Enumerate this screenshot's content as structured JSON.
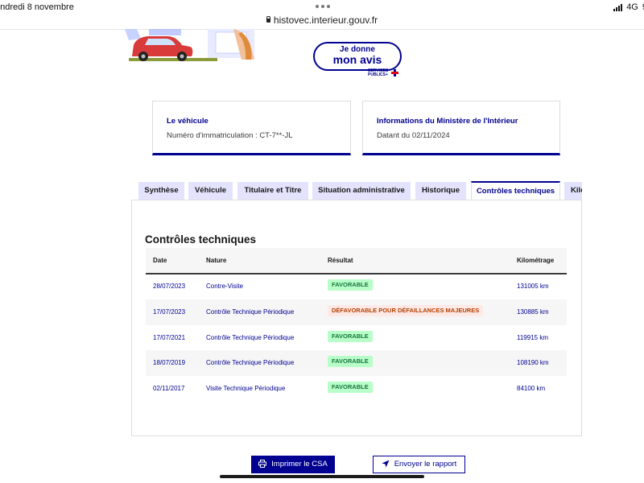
{
  "status": {
    "left": "endredi 8 novembre",
    "network": "4G",
    "battery_partial": "9"
  },
  "browser": {
    "url": "histovec.interieur.gouv.fr"
  },
  "avis": {
    "line1": "Je donne",
    "line2": "mon avis",
    "logo_l1": "SERVICES",
    "logo_l2": "PUBLICS+"
  },
  "cards": [
    {
      "title": "Le véhicule",
      "text": "Numéro d'immatriculation : CT-7**-JL"
    },
    {
      "title": "Informations du Ministère de l'Intérieur",
      "text": "Datant du 02/11/2024"
    }
  ],
  "tabs": [
    {
      "label": "Synthèse",
      "active": false
    },
    {
      "label": "Véhicule",
      "active": false
    },
    {
      "label": "Titulaire et Titre",
      "active": false
    },
    {
      "label": "Situation administrative",
      "active": false
    },
    {
      "label": "Historique",
      "active": false
    },
    {
      "label": "Contrôles techniques",
      "active": true
    },
    {
      "label": "Kilo",
      "active": false
    }
  ],
  "section": {
    "title": "Contrôles techniques"
  },
  "table": {
    "headers": [
      "Date",
      "Nature",
      "Résultat",
      "Kilométrage"
    ],
    "rows": [
      {
        "date": "28/07/2023",
        "nature": "Contre-Visite",
        "result": "FAVORABLE",
        "status": "ok",
        "km": "131005 km"
      },
      {
        "date": "17/07/2023",
        "nature": "Contrôle Technique Périodique",
        "result": "DÉFAVORABLE POUR DÉFAILLANCES MAJEURES",
        "status": "ko",
        "km": "130885 km"
      },
      {
        "date": "17/07/2021",
        "nature": "Contrôle Technique Périodique",
        "result": "FAVORABLE",
        "status": "ok",
        "km": "119915 km"
      },
      {
        "date": "18/07/2019",
        "nature": "Contrôle Technique Périodique",
        "result": "FAVORABLE",
        "status": "ok",
        "km": "108190 km"
      },
      {
        "date": "02/11/2017",
        "nature": "Visite Technique Périodique",
        "result": "FAVORABLE",
        "status": "ok",
        "km": "84100 km"
      }
    ]
  },
  "buttons": {
    "print": "Imprimer le CSA",
    "send": "Envoyer le rapport"
  },
  "colors": {
    "primary": "#000091",
    "ok_bg": "#b8fec9",
    "ok_text": "#18753c",
    "ko_bg": "#ffe9e6",
    "ko_text": "#b34000"
  },
  "icons": {
    "print": "printer-icon",
    "send": "send-icon",
    "lock": "lock-icon"
  }
}
